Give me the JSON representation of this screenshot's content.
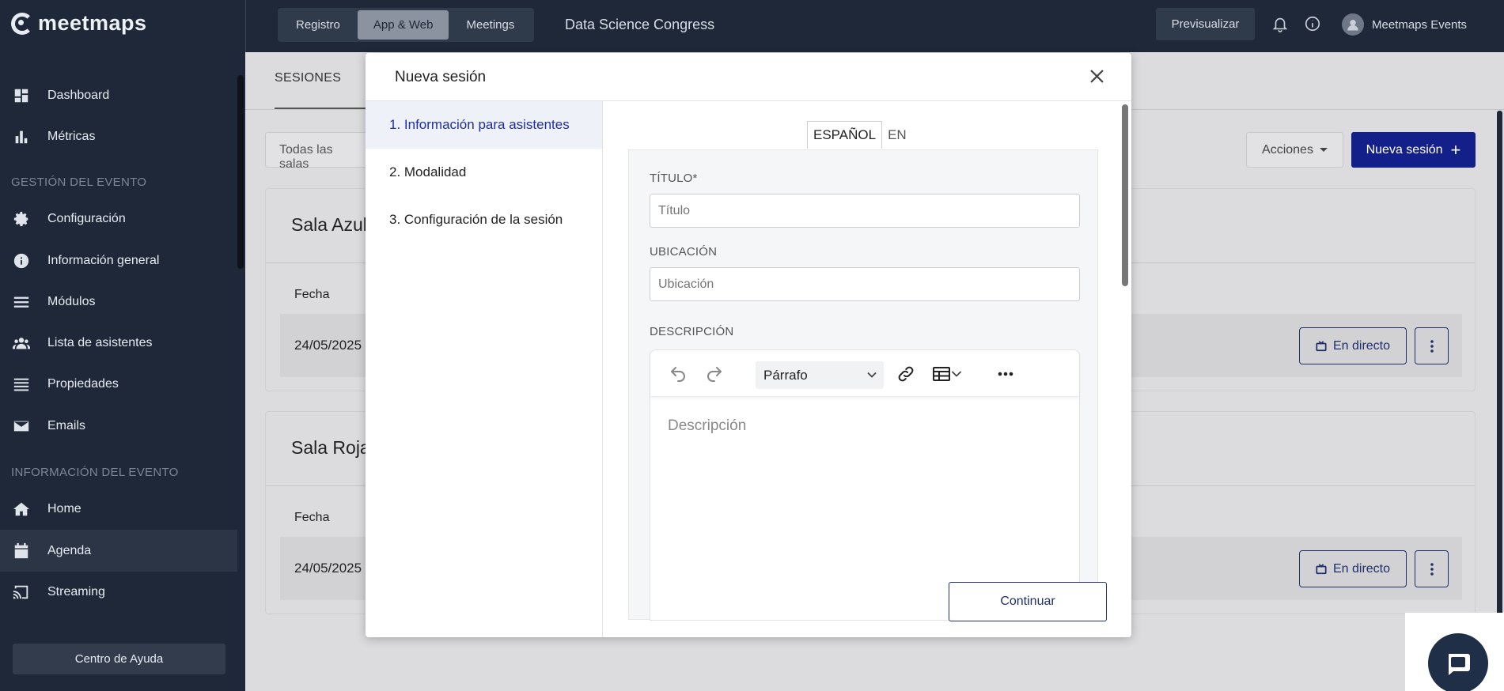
{
  "app": {
    "logo_text": "meetmaps"
  },
  "sidebar": {
    "items_top": [
      {
        "label": "Dashboard",
        "icon": "dashboard-icon"
      },
      {
        "label": "Métricas",
        "icon": "bar-chart-icon"
      }
    ],
    "section_event": "GESTIÓN DEL EVENTO",
    "items_event": [
      {
        "label": "Configuración",
        "icon": "gear-icon"
      },
      {
        "label": "Información general",
        "icon": "info-icon"
      },
      {
        "label": "Módulos",
        "icon": "menu-icon"
      },
      {
        "label": "Lista de asistentes",
        "icon": "users-icon"
      },
      {
        "label": "Propiedades",
        "icon": "list-icon"
      },
      {
        "label": "Emails",
        "icon": "mail-icon"
      }
    ],
    "section_info": "INFORMACIÓN DEL EVENTO",
    "items_info": [
      {
        "label": "Home",
        "icon": "home-icon"
      },
      {
        "label": "Agenda",
        "icon": "calendar-icon",
        "active": true
      },
      {
        "label": "Streaming",
        "icon": "cast-icon"
      }
    ],
    "help_label": "Centro de Ayuda"
  },
  "topbar": {
    "tabs": [
      "Registro",
      "App & Web",
      "Meetings"
    ],
    "active_tab": "App & Web",
    "event_name": "Data Science Congress",
    "preview_label": "Previsualizar",
    "account_name": "Meetmaps Events"
  },
  "background": {
    "tab_sessions": "SESIONES",
    "filter_label": "Todas las salas",
    "actions_label": "Acciones",
    "new_session_label": "Nueva sesión",
    "rooms": [
      {
        "name": "Sala Azul",
        "col_date": "Fecha",
        "date": "24/05/2025",
        "live_label": "En directo"
      },
      {
        "name": "Sala Roja",
        "col_date": "Fecha",
        "date": "24/05/2025",
        "live_label": "En directo"
      }
    ]
  },
  "modal": {
    "title": "Nueva sesión",
    "steps": [
      {
        "label": "1. Información para asistentes",
        "active": true
      },
      {
        "label": "2. Modalidad"
      },
      {
        "label": "3. Configuración de la sesión"
      }
    ],
    "lang_tabs": [
      "ESPAÑOL",
      "EN"
    ],
    "active_lang": "ESPAÑOL",
    "fields": {
      "title_label": "TÍTULO*",
      "title_placeholder": "Título",
      "location_label": "UBICACIÓN",
      "location_placeholder": "Ubicación",
      "description_label": "DESCRIPCIÓN",
      "description_placeholder": "Descripción"
    },
    "editor": {
      "block_format": "Párrafo"
    },
    "continue_label": "Continuar"
  },
  "colors": {
    "sidebar_bg": "#1e2838",
    "primary": "#13208a",
    "active_step_text": "#1f2fa0"
  }
}
